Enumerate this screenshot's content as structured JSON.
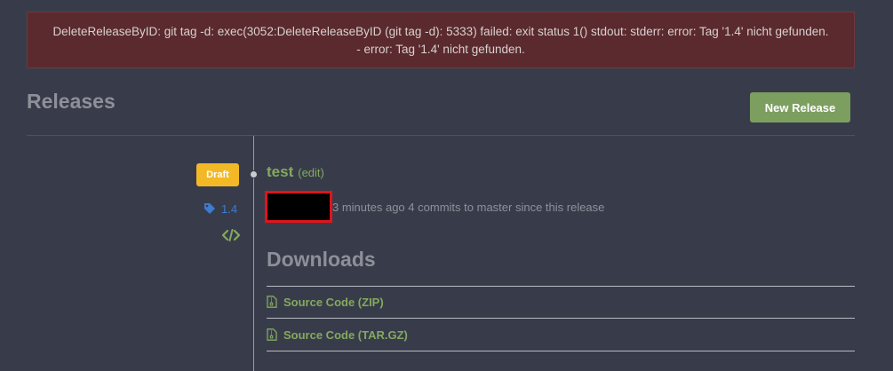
{
  "error": {
    "line1": "DeleteReleaseByID: git tag -d: exec(3052:DeleteReleaseByID (git tag -d): 5333) failed: exit status 1() stdout: stderr: error: Tag '1.4' nicht gefunden.",
    "line2": "- error: Tag '1.4' nicht gefunden."
  },
  "header": {
    "title": "Releases",
    "new_release_label": "New Release"
  },
  "release": {
    "badge": "Draft",
    "tag": "1.4",
    "name": "test",
    "edit_label": "(edit)",
    "meta_time": "3 minutes ago",
    "meta_commits": "4 commits",
    "meta_suffix": "to master since this release"
  },
  "downloads": {
    "title": "Downloads",
    "items": [
      {
        "label": "Source Code (ZIP)"
      },
      {
        "label": "Source Code (TAR.GZ)"
      }
    ]
  },
  "colors": {
    "background": "#383c4a",
    "error_bg": "#5a2a2e",
    "accent_green": "#84a95e",
    "button_green": "#7c9f60",
    "draft_yellow": "#f2b826",
    "tag_blue": "#3d7ccf",
    "redaction_border": "#e0141a"
  },
  "icons": {
    "tag": "tag-icon",
    "code": "code-icon",
    "file_zip": "file-zip-icon"
  }
}
